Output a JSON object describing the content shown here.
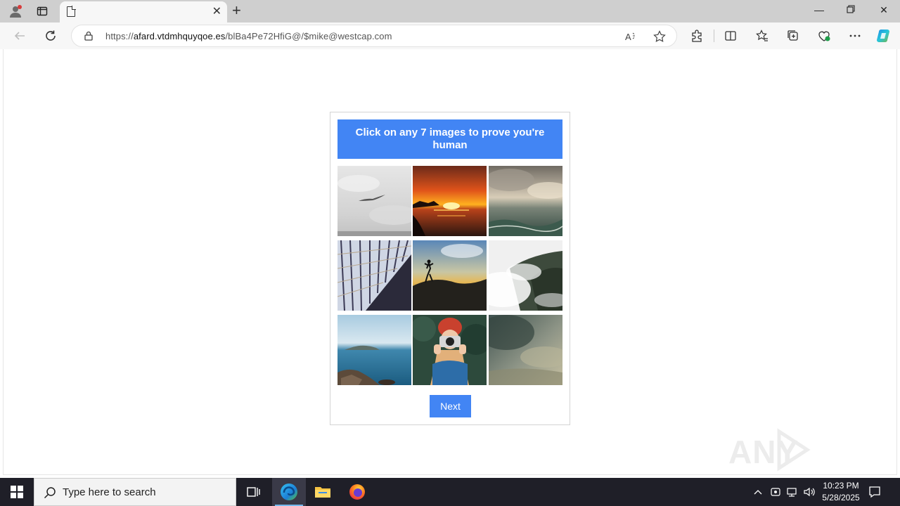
{
  "browser": {
    "tab_title": "",
    "url_prefix": "https://",
    "url_host": "afard.vtdmhquyqoe.es",
    "url_path": "/blBa4Pe72HfiG@/$mike@westcap.com"
  },
  "captcha": {
    "instruction": "Click on any 7 images to prove you're human",
    "next_label": "Next",
    "tiles": [
      {
        "name": "tile-bird-sky",
        "theme": "grey sky with bird"
      },
      {
        "name": "tile-sunset-sea",
        "theme": "orange sunset over sea"
      },
      {
        "name": "tile-cloudy-ocean",
        "theme": "cloudy ocean"
      },
      {
        "name": "tile-building-perspective",
        "theme": "building facade perspective"
      },
      {
        "name": "tile-hiker-sunset",
        "theme": "person jumping at sunset"
      },
      {
        "name": "tile-misty-mountain",
        "theme": "misty mountain forest"
      },
      {
        "name": "tile-rocky-coast",
        "theme": "rocky coast blue sea"
      },
      {
        "name": "tile-photographer",
        "theme": "woman with camera"
      },
      {
        "name": "tile-stormy-sky",
        "theme": "stormy sky"
      }
    ]
  },
  "watermark": {
    "text": "ANY RUN"
  },
  "taskbar": {
    "search_placeholder": "Type here to search",
    "time": "10:23 PM",
    "date": "5/28/2025"
  },
  "colors": {
    "accent": "#4285f4",
    "taskbar": "#1f1f28"
  }
}
